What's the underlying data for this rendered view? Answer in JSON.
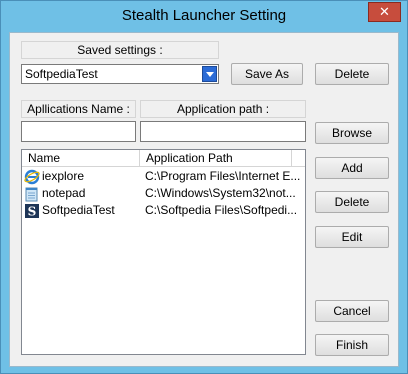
{
  "window": {
    "title": "Stealth Launcher Setting",
    "close_symbol": "✕"
  },
  "saved": {
    "label": "Saved settings :",
    "selected": "SoftpediaTest",
    "save_as_label": "Save As",
    "delete_label": "Delete"
  },
  "app": {
    "name_label": "Apllications Name :",
    "path_label": "Application path :",
    "name_value": "",
    "path_value": "",
    "browse_label": "Browse"
  },
  "list": {
    "columns": [
      "Name",
      "Application Path"
    ],
    "rows": [
      {
        "name": "iexplore",
        "path": "C:\\Program Files\\Internet E...",
        "icon": "internet-explorer-icon"
      },
      {
        "name": "notepad",
        "path": "C:\\Windows\\System32\\not...",
        "icon": "notepad-icon"
      },
      {
        "name": "SoftpediaTest",
        "path": "C:\\Softpedia Files\\Softpedi...",
        "icon": "softpedia-icon"
      }
    ]
  },
  "buttons": {
    "add": "Add",
    "delete": "Delete",
    "edit": "Edit",
    "cancel": "Cancel",
    "finish": "Finish"
  },
  "colors": {
    "title_bar": "#6fc0e6",
    "close": "#c74d3d",
    "combo_arrow": "#2b6bd6"
  }
}
